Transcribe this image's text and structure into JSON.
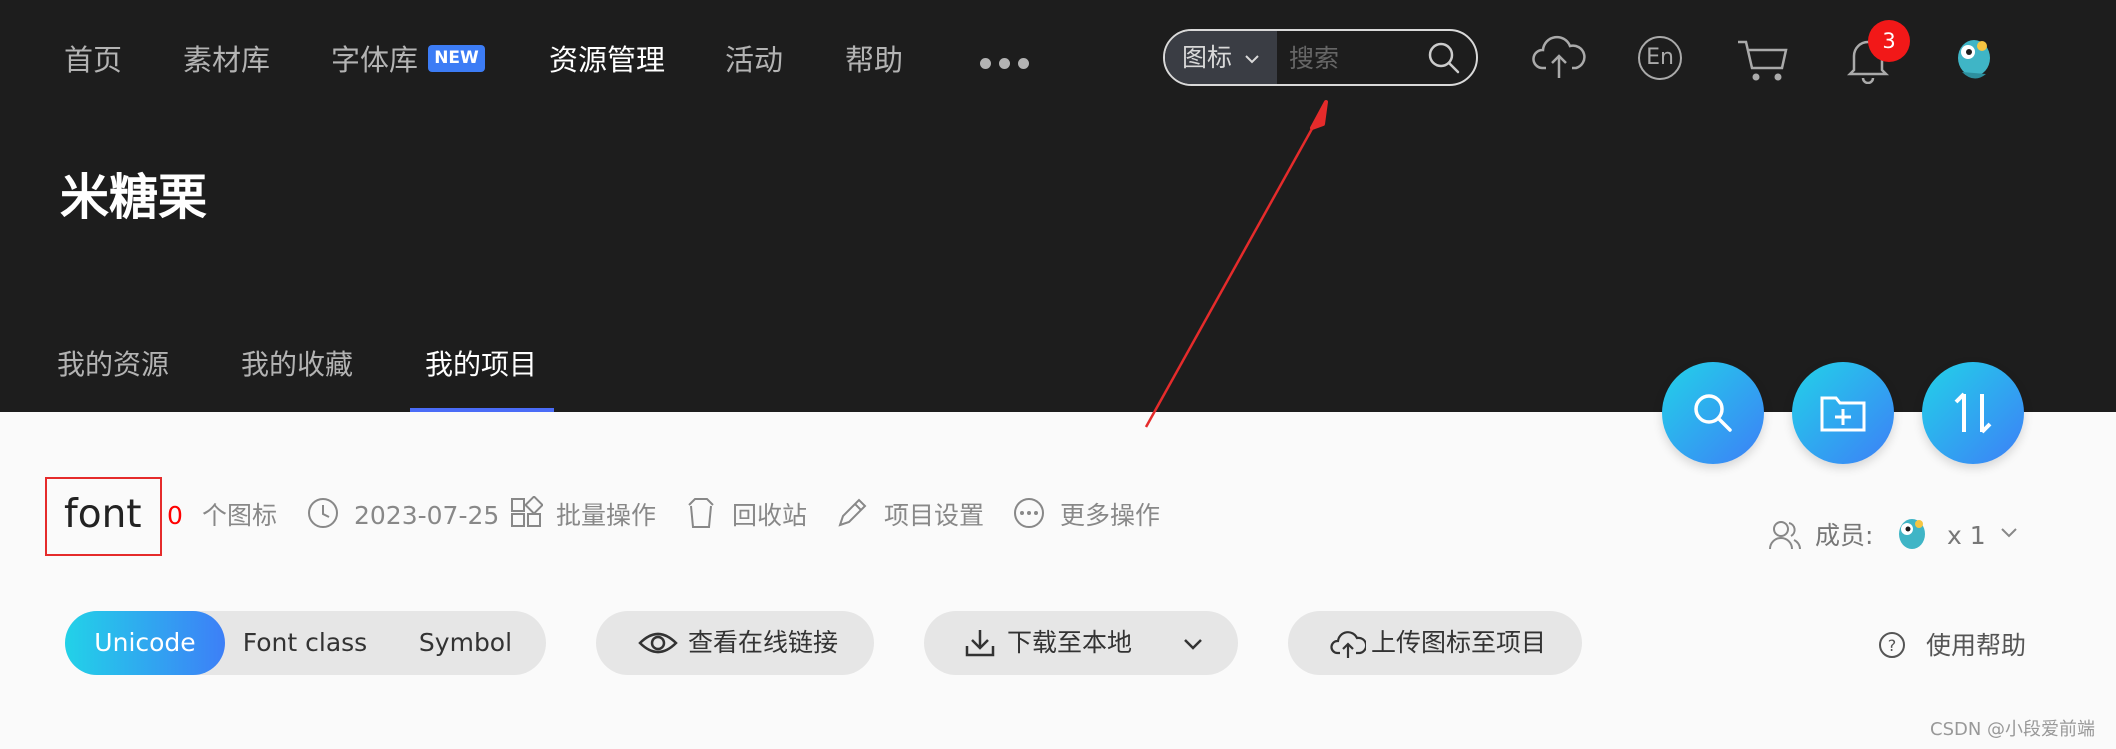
{
  "nav": {
    "items": [
      "首页",
      "素材库",
      "字体库",
      "资源管理",
      "活动",
      "帮助"
    ],
    "new_badge": "NEW",
    "more_icon": "more-dots-icon"
  },
  "search": {
    "type_label": "图标",
    "placeholder": "搜索"
  },
  "header_icons": {
    "upload": "cloud-upload-icon",
    "language": "En",
    "cart": "cart-icon",
    "bell": "bell-icon",
    "notification_count": "3",
    "avatar": "avatar"
  },
  "project": {
    "title": "米糖栗"
  },
  "sub_tabs": [
    "我的资源",
    "我的收藏",
    "我的项目"
  ],
  "fabs": [
    "search-icon",
    "add-folder-icon",
    "sort-icon"
  ],
  "font_project": {
    "name": "font",
    "icon_count": "0",
    "icon_count_label": "个图标",
    "date": "2023-07-25",
    "batch": "批量操作",
    "recycle": "回收站",
    "settings": "项目设置",
    "more": "更多操作",
    "members_label": "成员:",
    "members_count": "x 1"
  },
  "code_types": [
    "Unicode",
    "Font class",
    "Symbol"
  ],
  "buttons": {
    "view_link": "查看在线链接",
    "download": "下载至本地",
    "upload": "上传图标至项目",
    "help": "使用帮助"
  },
  "watermark": "CSDN @小段爱前端",
  "colors": {
    "header_bg": "#1d1d1d",
    "accent": "#3d7ff7",
    "accent2": "#22d2e8",
    "annotation": "#e52b2b"
  }
}
